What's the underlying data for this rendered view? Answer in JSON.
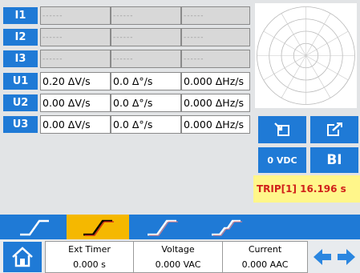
{
  "rows": [
    {
      "label": "I1",
      "v1": "------",
      "v2": "------",
      "v3": "------"
    },
    {
      "label": "I2",
      "v1": "------",
      "v2": "------",
      "v3": "------"
    },
    {
      "label": "I3",
      "v1": "------",
      "v2": "------",
      "v3": "------"
    },
    {
      "label": "U1",
      "v1": "0.20 ΔV/s",
      "v2": "0.0 Δ°/s",
      "v3": "0.000 ΔHz/s"
    },
    {
      "label": "U2",
      "v1": "0.00 ΔV/s",
      "v2": "0.0 Δ°/s",
      "v3": "0.000 ΔHz/s"
    },
    {
      "label": "U3",
      "v1": "0.00 ΔV/s",
      "v2": "0.0 Δ°/s",
      "v3": "0.000 ΔHz/s"
    }
  ],
  "buttons": {
    "import_icon": "import-icon",
    "edit_icon": "edit-icon",
    "vdc_label": "0 VDC",
    "bi_label": "BI"
  },
  "trip_text": "TRIP[1] 16.196 s",
  "tabs": [
    {
      "icon": "ramp-icon",
      "active": false
    },
    {
      "icon": "ramp-icon",
      "active": true
    },
    {
      "icon": "ramp-icon",
      "active": false
    },
    {
      "icon": "step-ramp-icon",
      "active": false
    }
  ],
  "status": {
    "ext_timer_label": "Ext Timer",
    "ext_timer_value": "0.000 s",
    "voltage_label": "Voltage",
    "voltage_value": "0.000 VAC",
    "current_label": "Current",
    "current_value": "0.000 AAC"
  },
  "colors": {
    "accent_blue": "#1f7ad6",
    "active_tab": "#f5b800",
    "trip_bg": "#fff68a",
    "trip_text": "#d0201a"
  }
}
